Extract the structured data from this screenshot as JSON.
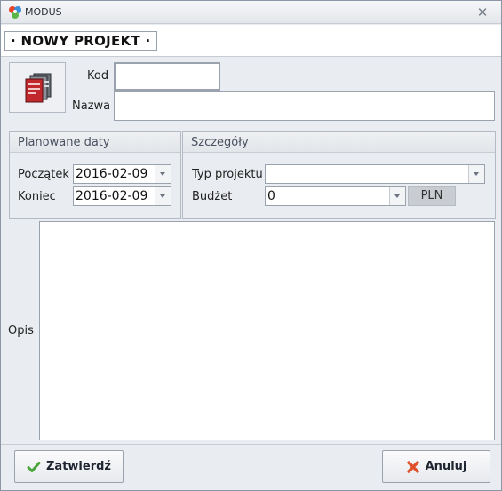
{
  "window": {
    "title": "MODUS",
    "close_glyph": "✕"
  },
  "header": {
    "title": "· NOWY PROJEKT ·"
  },
  "form": {
    "kod_label": "Kod",
    "kod_value": "",
    "nazwa_label": "Nazwa",
    "nazwa_value": ""
  },
  "planned_dates": {
    "group_title": "Planowane daty",
    "start_label": "Początek",
    "start_value": "2016-02-09",
    "end_label": "Koniec",
    "end_value": "2016-02-09"
  },
  "details": {
    "group_title": "Szczegóły",
    "type_label": "Typ projektu",
    "type_value": "",
    "budget_label": "Budżet",
    "budget_value": "0",
    "currency": "PLN"
  },
  "description": {
    "label": "Opis",
    "value": ""
  },
  "footer": {
    "confirm_label": "Zatwierdź",
    "cancel_label": "Anuluj"
  },
  "icons": {
    "app_logo": "modus-logo-icon",
    "project": "folders-icon",
    "confirm": "checkmark-icon",
    "cancel": "x-icon",
    "dropdown": "chevron-down-icon"
  },
  "colors": {
    "confirm_check": "#4aa53a",
    "cancel_x": "#e0522b",
    "frame": "#e9ecf0"
  }
}
